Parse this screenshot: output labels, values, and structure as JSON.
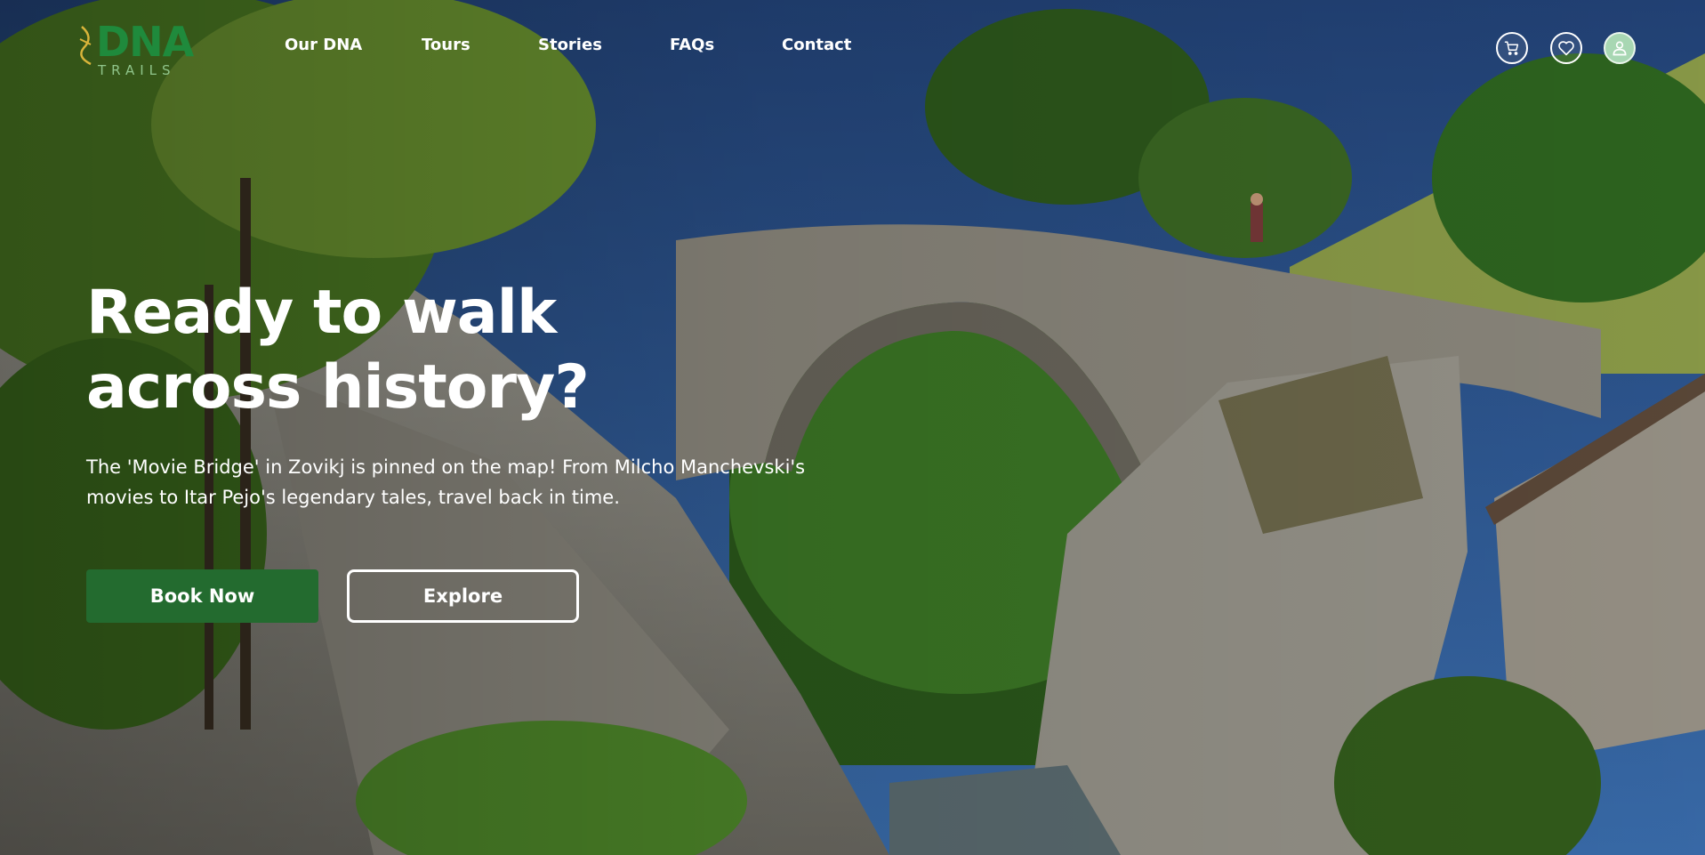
{
  "brand": {
    "name": "DNA",
    "tagline": "TRAILS",
    "color": "#1f8a3c"
  },
  "nav": {
    "items": [
      {
        "label": "Our DNA"
      },
      {
        "label": "Tours"
      },
      {
        "label": "Stories"
      },
      {
        "label": "FAQs"
      },
      {
        "label": "Contact"
      }
    ]
  },
  "actions": {
    "icons": [
      "cart-icon",
      "heart-icon",
      "user-icon"
    ]
  },
  "hero": {
    "title": "Ready to walk across history?",
    "subtitle": "The 'Movie Bridge' in Zovikj is pinned on the map! From Milcho Manchevski's movies to Itar Pejo's legendary tales, travel back in time.",
    "primary_cta": "Book Now",
    "secondary_cta": "Explore",
    "primary_color": "#236b2f"
  }
}
